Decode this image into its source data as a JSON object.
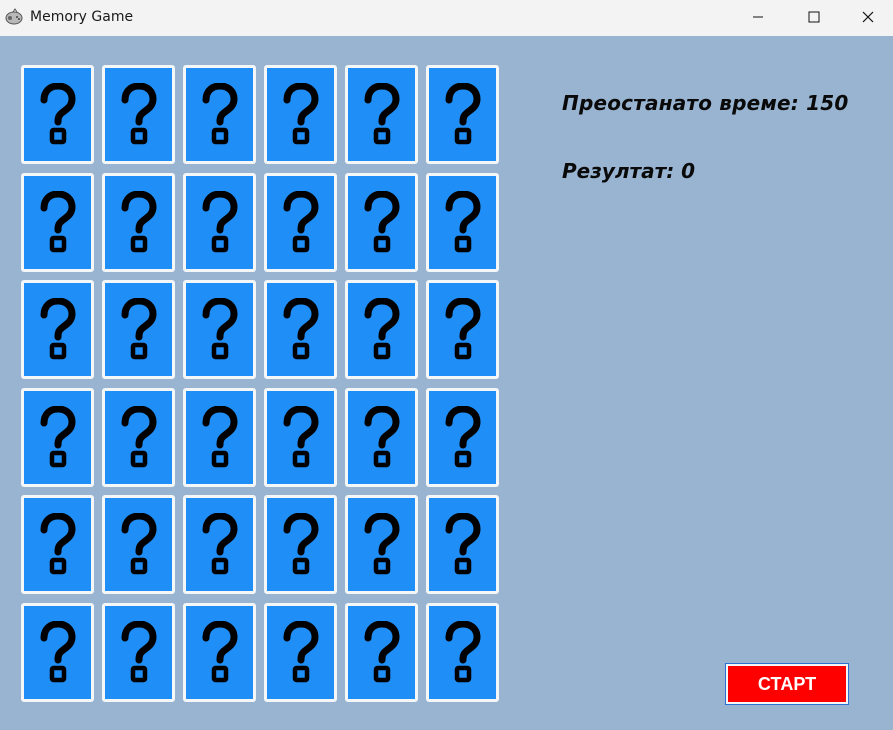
{
  "window": {
    "title": "Memory Game",
    "app_icon": "game-controller-icon",
    "controls": [
      "minimize-icon",
      "maximize-icon",
      "close-icon"
    ]
  },
  "board": {
    "rows": 6,
    "cols": 6,
    "card_face": "question-mark-icon",
    "card_color": "#1f8ef7",
    "card_border_color": "#f4f6f8"
  },
  "status": {
    "time_label": "Преостанато време: 150",
    "score_label": "Резултат: 0"
  },
  "start_button": {
    "label": "СТАРТ",
    "color": "#ff0000"
  },
  "colors": {
    "background": "#98b4d1",
    "titlebar": "#f3f3f3"
  }
}
